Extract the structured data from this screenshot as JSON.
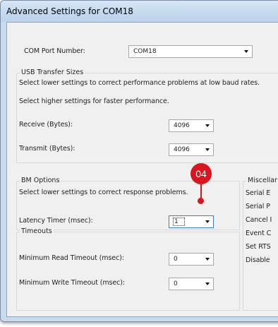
{
  "window": {
    "title": "Advanced Settings for COM18"
  },
  "com_port": {
    "label": "COM Port Number:",
    "value": "COM18"
  },
  "usb": {
    "title": "USB Transfer Sizes",
    "desc1": "Select lower settings to correct performance problems at low baud rates.",
    "desc2": "Select higher settings for faster performance.",
    "receive_label": "Receive (Bytes):",
    "receive_value": "4096",
    "transmit_label": "Transmit (Bytes):",
    "transmit_value": "4096"
  },
  "bm": {
    "title": "BM Options",
    "desc": "Select lower settings to correct response problems.",
    "latency_label": "Latency Timer (msec):",
    "latency_value": "1"
  },
  "timeouts": {
    "title": "Timeouts",
    "read_label": "Minimum Read Timeout (msec):",
    "read_value": "0",
    "write_label": "Minimum Write Timeout (msec):",
    "write_value": "0"
  },
  "misc": {
    "title": "Miscellar",
    "items": [
      "Serial E",
      "Serial P",
      "Cancel I",
      "Event C",
      "Set RTS",
      "Disable"
    ]
  },
  "callout": {
    "number": "04",
    "color": "#d9161f"
  }
}
